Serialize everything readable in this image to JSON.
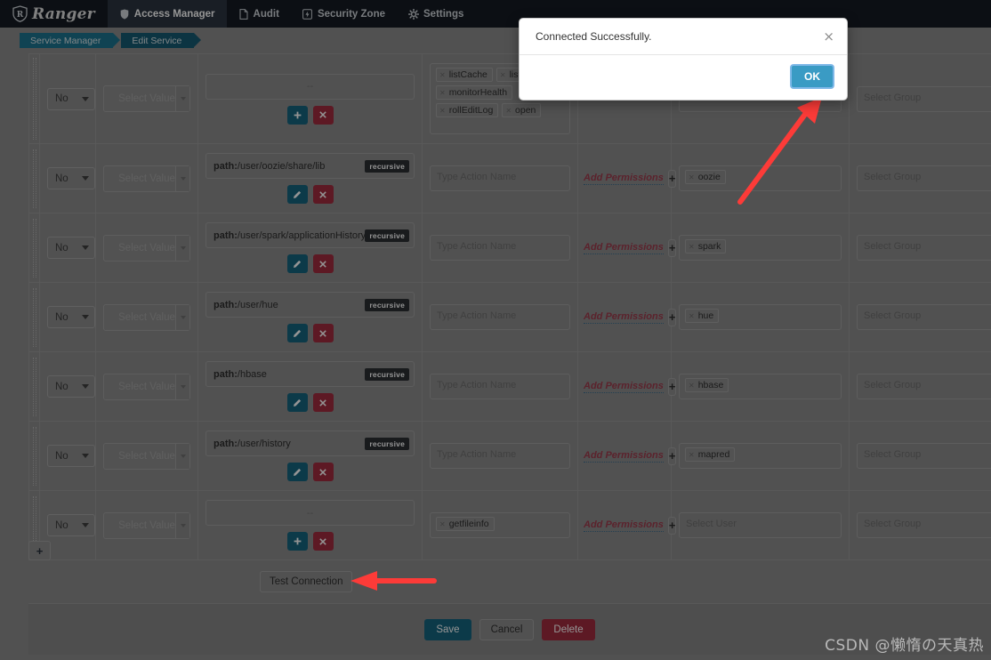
{
  "app": {
    "brand": "Ranger",
    "brand_icon": "shield-r-logo",
    "nav": [
      {
        "label": "Access Manager",
        "icon": "shield-icon",
        "active": true
      },
      {
        "label": "Audit",
        "icon": "file-icon",
        "active": false
      },
      {
        "label": "Security Zone",
        "icon": "zone-icon",
        "active": false
      },
      {
        "label": "Settings",
        "icon": "gear-icon",
        "active": false
      }
    ]
  },
  "breadcrumb": [
    {
      "label": "Service Manager"
    },
    {
      "label": "Edit Service"
    }
  ],
  "modal": {
    "message": "Connected Successfully.",
    "close_icon": "close-icon",
    "ok_label": "OK"
  },
  "labels": {
    "select_value": "Select Value",
    "select_user": "Select User",
    "select_group": "Select Group",
    "type_action_name": "Type Action Name",
    "add_permissions": "Add Permissions",
    "recursive": "recursive",
    "empty_path": "--",
    "plus": "+",
    "close_x": "×",
    "exclude_no": "No"
  },
  "colors": {
    "navbar": "#151b23",
    "crumb_active": "#1d7490",
    "crumb_current": "#165a72",
    "blue_button": "#16657f",
    "red_button": "#a02c3f",
    "ok_button": "#3a9bc4",
    "page_bg": "#8c8c8c",
    "add_perm_link": "#9e3b4d"
  },
  "rows": [
    {
      "exclude": "No",
      "value": "Select Value",
      "path": "",
      "path_placeholder": "--",
      "recursive": false,
      "actions_placeholder": "",
      "actions": [
        "listCache",
        "listCorru",
        "monitorHealth",
        "rollEditLog",
        "open"
      ],
      "permissions": "",
      "users": [],
      "users_placeholder": "",
      "groups_placeholder": "Select Group",
      "first": true
    },
    {
      "exclude": "No",
      "value": "Select Value",
      "path": "/user/oozie/share/lib",
      "recursive": true,
      "actions_placeholder": "Type Action Name",
      "actions": [],
      "permissions": "Add Permissions",
      "users": [
        "oozie"
      ],
      "groups_placeholder": "Select Group"
    },
    {
      "exclude": "No",
      "value": "Select Value",
      "path": "/user/spark/applicationHistory",
      "recursive": true,
      "actions_placeholder": "Type Action Name",
      "actions": [],
      "permissions": "Add Permissions",
      "users": [
        "spark"
      ],
      "groups_placeholder": "Select Group"
    },
    {
      "exclude": "No",
      "value": "Select Value",
      "path": "/user/hue",
      "recursive": true,
      "actions_placeholder": "Type Action Name",
      "actions": [],
      "permissions": "Add Permissions",
      "users": [
        "hue"
      ],
      "groups_placeholder": "Select Group"
    },
    {
      "exclude": "No",
      "value": "Select Value",
      "path": "/hbase",
      "recursive": true,
      "actions_placeholder": "Type Action Name",
      "actions": [],
      "permissions": "Add Permissions",
      "users": [
        "hbase"
      ],
      "groups_placeholder": "Select Group"
    },
    {
      "exclude": "No",
      "value": "Select Value",
      "path": "/user/history",
      "recursive": true,
      "actions_placeholder": "Type Action Name",
      "actions": [],
      "permissions": "Add Permissions",
      "users": [
        "mapred"
      ],
      "groups_placeholder": "Select Group"
    },
    {
      "exclude": "No",
      "value": "Select Value",
      "path": "",
      "path_placeholder": "--",
      "recursive": false,
      "actions_placeholder": "",
      "actions": [
        "getfileinfo"
      ],
      "permissions": "Add Permissions",
      "users": [],
      "users_placeholder": "Select User",
      "groups_placeholder": "Select Group",
      "last": true
    }
  ],
  "path_prefix": "path:",
  "bottom": {
    "add_row": "+",
    "test_connection": "Test Connection",
    "save": "Save",
    "cancel": "Cancel",
    "delete": "Delete"
  },
  "watermark": "CSDN @懒惰の天真热"
}
